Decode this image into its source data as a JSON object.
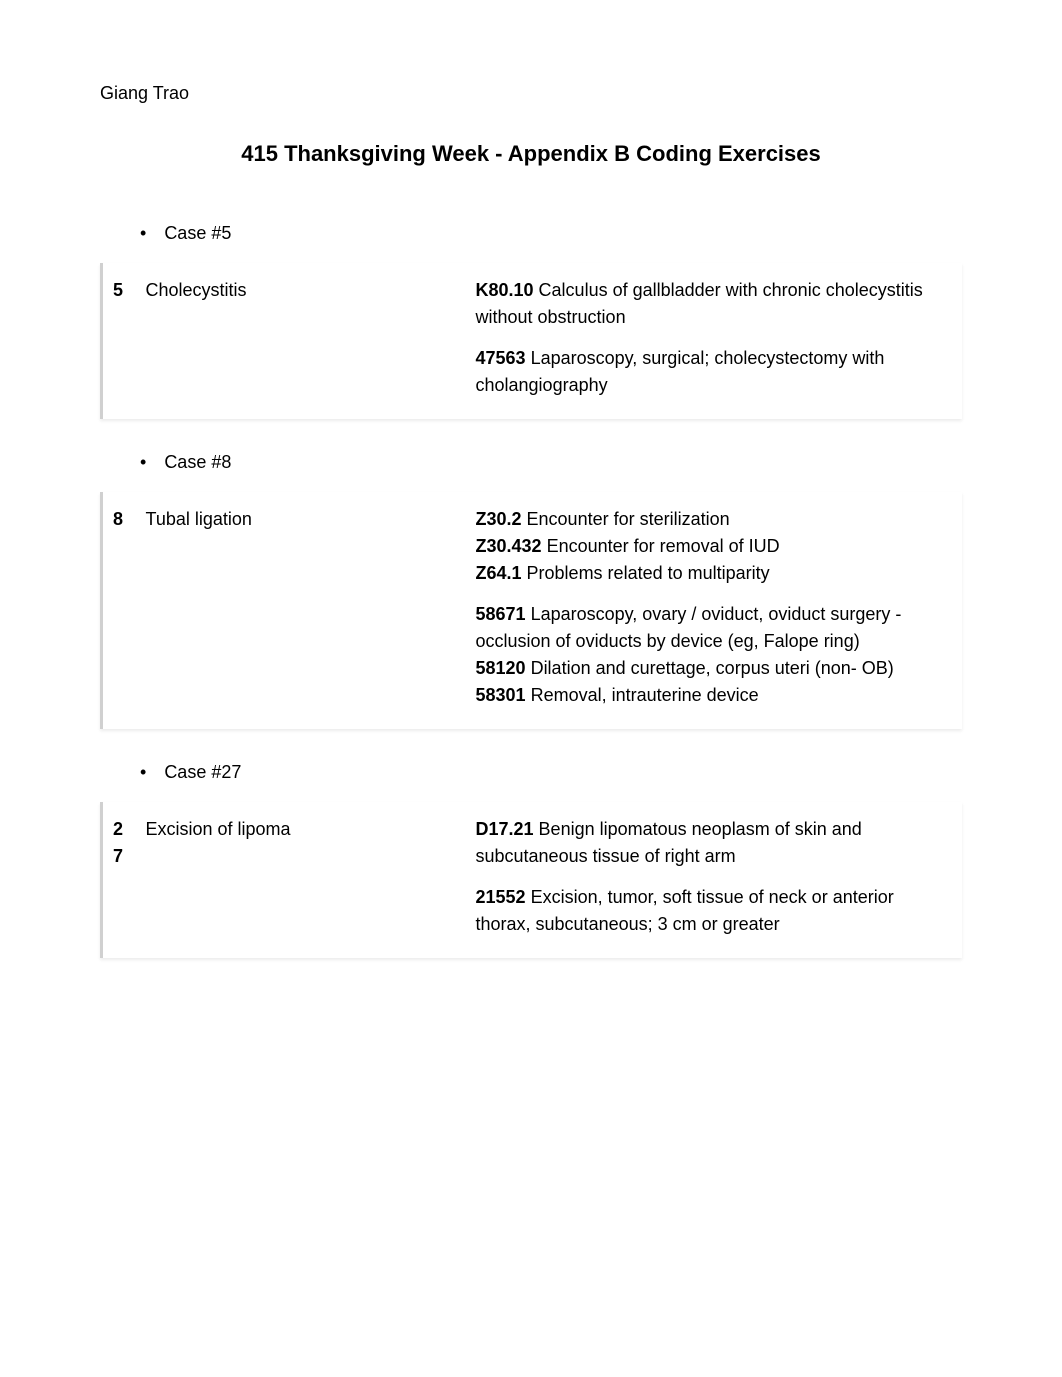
{
  "author": "Giang Trao",
  "title": "415 Thanksgiving Week - Appendix B Coding Exercises",
  "cases": [
    {
      "bullet_label": "Case #5",
      "num": "5",
      "desc": "Cholecystitis",
      "codes": [
        {
          "code": "K80.10",
          "text": " Calculus of gallbladder with chronic cholecystitis without obstruction"
        },
        {
          "spacer": true
        },
        {
          "code": "47563",
          "text": " Laparoscopy, surgical; cholecystectomy with cholangiography"
        }
      ]
    },
    {
      "bullet_label": "Case #8",
      "num": "8",
      "desc": "Tubal ligation",
      "codes": [
        {
          "code": "Z30.2",
          "text": " Encounter for sterilization"
        },
        {
          "code": "Z30.432",
          "text": " Encounter for removal of IUD"
        },
        {
          "code": "Z64.1",
          "text": " Problems related to multiparity"
        },
        {
          "spacer": true
        },
        {
          "code": "58671",
          "text": " Laparoscopy, ovary / oviduct, oviduct surgery - occlusion of oviducts by device (eg, Falope ring)"
        },
        {
          "code": "58120",
          "text": " Dilation and curettage, corpus uteri (non- OB)"
        },
        {
          "code": "58301",
          "text": " Removal, intrauterine device"
        }
      ]
    },
    {
      "bullet_label": "Case #27",
      "num_a": "2",
      "num_b": "7",
      "desc": "Excision of lipoma",
      "codes": [
        {
          "code": "D17.21",
          "text": " Benign lipomatous neoplasm of skin and subcutaneous tissue of right arm"
        },
        {
          "spacer": true
        },
        {
          "code": "21552",
          "text": " Excision, tumor, soft tissue of neck or anterior thorax, subcutaneous; 3 cm or greater"
        }
      ]
    }
  ]
}
